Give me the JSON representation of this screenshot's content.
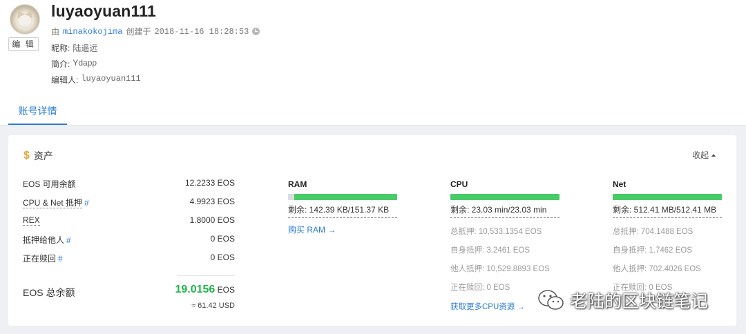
{
  "account": {
    "name": "luyaoyuan111",
    "edit_label": "编 辑",
    "created_prefix": "由",
    "creator": "minakokojima",
    "created_word": "创建于",
    "created_at": "2018-11-16 18:28:53",
    "nickname_label": "昵称:",
    "nickname": "陆遥远",
    "intro_label": "简介:",
    "intro": "Ydapp",
    "editor_label": "编辑人:",
    "editor": "luyaoyuan111"
  },
  "tabs": [
    {
      "label": "账号详情",
      "active": true
    }
  ],
  "assets": {
    "title": "资产",
    "collapse_label": "收起",
    "rows": [
      {
        "label": "EOS 可用余额",
        "value": "12.2233 EOS",
        "hash": ""
      },
      {
        "label": "CPU & Net 抵押",
        "value": "4.9923 EOS",
        "hash": "#"
      },
      {
        "label": "REX",
        "value": "1.8000 EOS",
        "hash": ""
      },
      {
        "label": "抵押给他人",
        "value": "0 EOS",
        "hash": "#"
      },
      {
        "label": "正在赎回",
        "value": "0 EOS",
        "hash": "#"
      }
    ],
    "total_label": "EOS 总余额",
    "total_value": "19.0156",
    "total_unit": "EOS",
    "total_usd": "≈ 61.42 USD"
  },
  "resources": {
    "ram": {
      "title": "RAM",
      "usage_fraction": 0.06,
      "remain": "剩余: 142.39 KB/151.37 KB",
      "buy": "购买 RAM →"
    },
    "cpu": {
      "title": "CPU",
      "usage_fraction": 0.0,
      "remain": "剩余: 23.03 min/23.03 min",
      "stats": [
        "总抵押: 10,533.1354 EOS",
        "自身抵押: 3.2461 EOS",
        "他人抵押: 10,529.8893 EOS",
        "正在赎回: 0 EOS"
      ],
      "more": "获取更多CPU资源 →"
    },
    "net": {
      "title": "Net",
      "usage_fraction": 0.0,
      "remain": "剩余: 512.41 MB/512.41 MB",
      "stats": [
        "总抵押: 704.1488 EOS",
        "自身抵押: 1.7462 EOS",
        "他人抵押: 702.4026 EOS",
        "正在赎回: 0 EOS"
      ]
    }
  },
  "watermark": {
    "text": "老陆的区块链笔记",
    "icon": "wechat-icon"
  },
  "colors": {
    "accent": "#2b7bd6",
    "bar_green": "#48cc67",
    "total_green": "#21b34b",
    "dollar": "#e6a23c"
  }
}
